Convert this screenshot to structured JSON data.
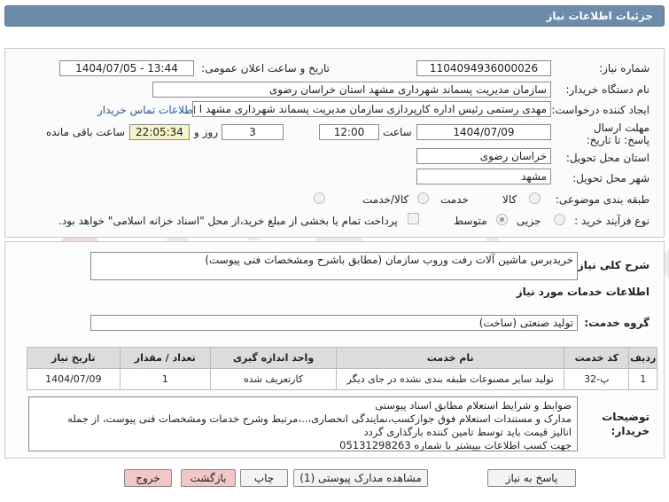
{
  "header": {
    "title": "جزئیات اطلاعات نیاز"
  },
  "watermark": {
    "text": "AriaTender.neT"
  },
  "form": {
    "need_number_label": "شماره نیاز:",
    "need_number_value": "1104094936000026",
    "announce_label": "تاریخ و ساعت اعلان عمومی:",
    "announce_value": "1404/07/05 - 13:44",
    "buyer_label": "نام دستگاه خریدار:",
    "buyer_value": "سازمان مدیریت پسماند شهرداری مشهد استان خراسان رضوی",
    "creator_label": "ایجاد کننده درخواست:",
    "creator_value": "مهدی رستمی رئیس اداره کارپردازی سازمان مدیریت پسماند شهرداری مشهد ا",
    "contact_link": "اطلاعات تماس خریدار",
    "deadline_label": "مهلت ارسال پاسخ: تا تاریخ:",
    "deadline_date": "1404/07/09",
    "time_label": "ساعت",
    "deadline_time": "12:00",
    "days_value": "3",
    "days_label": "روز و",
    "remaining_value": "22:05:34",
    "remaining_label": "ساعت باقی مانده",
    "province_label": "استان محل تحویل:",
    "province_value": "خراسان رضوی",
    "city_label": "شهر محل تحویل:",
    "city_value": "مشهد",
    "category_label": "طبقه بندی موضوعی:",
    "category_options": [
      "کالا",
      "خدمت",
      "کالا/خدمت"
    ],
    "process_label": "نوع فرآیند خرید :",
    "process_options": [
      "جزیی",
      "متوسط"
    ],
    "payment_note": "پرداخت تمام یا بخشی از مبلغ خرید،از محل \"اسناد خزانه اسلامی\" خواهد بود."
  },
  "summary": {
    "label": "شرح کلی نیاز:",
    "value": "خریدبرس ماشین آلات رفت وروب سازمان (مطابق باشرح ومشخصات فنی پیوست)"
  },
  "services": {
    "section_title": "اطلاعات خدمات مورد نیاز",
    "group_label": "گروه خدمت:",
    "group_value": "تولید صنعتی (ساخت)",
    "columns": [
      "ردیف",
      "کد خدمت",
      "نام خدمت",
      "واحد اندازه گیری",
      "تعداد / مقدار",
      "تاریخ نیاز"
    ],
    "rows": [
      {
        "row": "1",
        "code": "پ-32",
        "name": "تولید سایر مصنوعات طبقه بندی نشده در جای دیگر",
        "unit": "کارتعریف شده",
        "qty": "1",
        "date": "1404/07/09"
      }
    ]
  },
  "buyer_notes": {
    "label": "توضیحات خریدار:",
    "lines": [
      "ضوابط و شرایط استعلام مطابق اسناد پیوستی",
      "مدارک و مستندات استعلام فوق جوازکسب،نمایندگی انحصاری،..،مرتبط وشرح خدمات ومشخصات فنی پیوست، از جمله",
      "انالیز قیمت باید توسط تامین کننده بارگذاری گردد",
      "جهت کسب اطلاعات بییشتر با شماره 05131298263"
    ]
  },
  "buttons": {
    "respond": "پاسخ به نیاز",
    "attachments": "مشاهده مدارک پیوستی (1)",
    "print": "چاپ",
    "back": "بازگشت",
    "exit": "خروج"
  }
}
